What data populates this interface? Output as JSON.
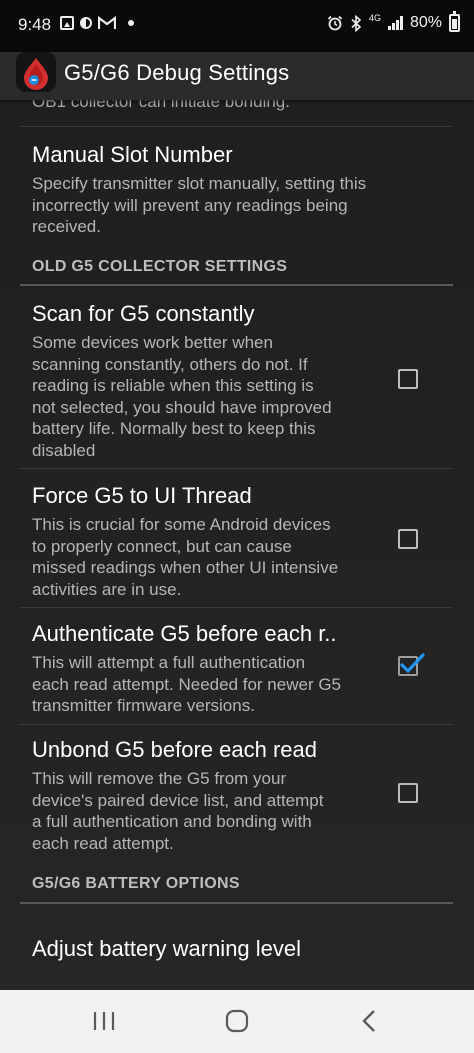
{
  "status_bar": {
    "time": "9:48",
    "network": "4G",
    "battery": "80%"
  },
  "app_bar": {
    "title": "G5/G6 Debug Settings",
    "icon": "xdrip-blood-drop-icon"
  },
  "top_partial_text": "OB1 collector can initiate bonding.",
  "manual_slot": {
    "title": "Manual Slot Number",
    "summary_lines": [
      "Specify transmitter slot manually, setting this",
      "incorrectly will prevent any readings being",
      "received."
    ]
  },
  "sections": {
    "old_g5": "OLD G5 COLLECTOR SETTINGS",
    "battery": "G5/G6 BATTERY OPTIONS"
  },
  "prefs": [
    {
      "title": "Scan for G5 constantly",
      "summary_lines": [
        "Some devices work better when",
        "scanning constantly, others do not. If",
        "reading is reliable when this setting is",
        "not selected, you should have improved",
        "battery life. Normally best to keep this",
        "disabled"
      ],
      "checked": false
    },
    {
      "title": "Force G5 to UI Thread",
      "summary_lines": [
        "This is crucial for some Android devices",
        "to properly connect, but can cause",
        "missed readings when other UI intensive",
        "activities are in use."
      ],
      "checked": false
    },
    {
      "title": "Authenticate G5 before each r..",
      "summary_lines": [
        "This will attempt a full authentication",
        "each read attempt. Needed for newer G5",
        "transmitter firmware versions."
      ],
      "checked": true
    },
    {
      "title": "Unbond G5 before each read",
      "summary_lines": [
        "This will remove the G5 from your",
        "device's paired device list, and attempt",
        "a full authentication and bonding with",
        "each read attempt."
      ],
      "checked": false
    }
  ],
  "battery_warning": {
    "title": "Adjust battery warning level"
  },
  "colors": {
    "accent_check": "#2196f3",
    "background": "#212121",
    "app_bar": "#2b2b2b"
  }
}
